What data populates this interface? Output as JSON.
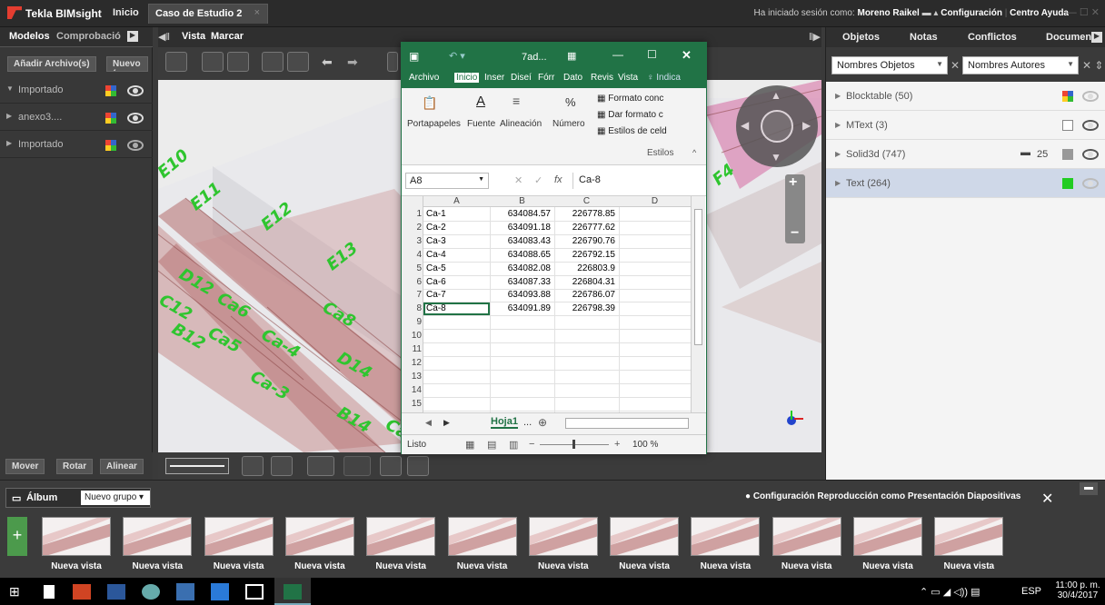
{
  "titlebar": {
    "app": "Tekla BIMsight",
    "home": "Inicio",
    "tab": "Caso de Estudio 2",
    "close": "×",
    "session_prefix": "Ha iniciado sesión como:",
    "user": "Moreno Raikel",
    "settings": "Configuración",
    "help": "Centro Ayuda"
  },
  "left": {
    "tab1": "Modelos",
    "tab2": "Comprobació",
    "add_btn": "Añadir Archivo(s)",
    "new_btn": "Nuevo (",
    "items": [
      {
        "label": "Importado"
      },
      {
        "label": "anexo3...."
      },
      {
        "label": "Importado"
      }
    ],
    "bottom": {
      "move": "Mover",
      "rotate": "Rotar",
      "align": "Alinear"
    }
  },
  "viewport": {
    "tab1": "Vista",
    "tab2": "Marcar",
    "labels": [
      "E10",
      "E11",
      "E12",
      "E13",
      "D12",
      "Ca6",
      "Ca8",
      "C12",
      "Ca5",
      "Ca-4",
      "D14",
      "B12",
      "Ca-3",
      "B14",
      "Ca",
      "F4"
    ]
  },
  "right": {
    "tabs": [
      "Objetos",
      "Notas",
      "Conflictos",
      "Documen"
    ],
    "select1": "Nombres Objetos",
    "select2": "Nombres Autores",
    "items": [
      {
        "label": "Blocktable (50)"
      },
      {
        "label": "MText (3)"
      },
      {
        "label": "Solid3d (747)",
        "comments": "25"
      },
      {
        "label": "Text (264)"
      }
    ]
  },
  "album": {
    "title": "Álbum",
    "group": "Nuevo grupo",
    "slideshow": "Configuración Reproducción como Presentación Diapositivas",
    "thumbs": [
      "Nueva vista",
      "Nueva vista",
      "Nueva vista",
      "Nueva vista",
      "Nueva vista",
      "Nueva vista",
      "Nueva vista",
      "Nueva vista",
      "Nueva vista",
      "Nueva vista",
      "Nueva vista",
      "Nueva vista"
    ]
  },
  "excel": {
    "title": "7ad...",
    "menu": [
      "Archivo",
      "Inicio",
      "Inser",
      "Diseí",
      "Fórr",
      "Dato",
      "Revis",
      "Vista",
      "Indica"
    ],
    "ribbon": {
      "clipboard": "Portapapeles",
      "font": "Fuente",
      "alignment": "Alineación",
      "number": "Número",
      "cond": "Formato conc",
      "table": "Dar formato c",
      "cellstyles": "Estilos de celd",
      "styles": "Estilos"
    },
    "namebox": "A8",
    "formula": "Ca-8",
    "fx": "fx",
    "cols": [
      "A",
      "B",
      "C",
      "D"
    ],
    "rows": [
      [
        "Ca-1",
        "634084.57",
        "226778.85"
      ],
      [
        "Ca-2",
        "634091.18",
        "226777.62"
      ],
      [
        "Ca-3",
        "634083.43",
        "226790.76"
      ],
      [
        "Ca-4",
        "634088.65",
        "226792.15"
      ],
      [
        "Ca-5",
        "634082.08",
        "226803.9"
      ],
      [
        "Ca-6",
        "634087.33",
        "226804.31"
      ],
      [
        "Ca-7",
        "634093.88",
        "226786.07"
      ],
      [
        "Ca-8",
        "634091.89",
        "226798.39"
      ]
    ],
    "rownums": [
      "1",
      "2",
      "3",
      "4",
      "5",
      "6",
      "7",
      "8",
      "9",
      "10",
      "11",
      "12",
      "13",
      "14",
      "15"
    ],
    "sheet": "Hoja1",
    "sheet_more": "...",
    "status": "Listo",
    "zoom": "100 %"
  },
  "taskbar": {
    "lang": "ESP",
    "time": "11:00 p. m.",
    "date": "30/4/2017"
  },
  "colors": {
    "excel": "#217346",
    "accent_label": "#2fc52f"
  }
}
